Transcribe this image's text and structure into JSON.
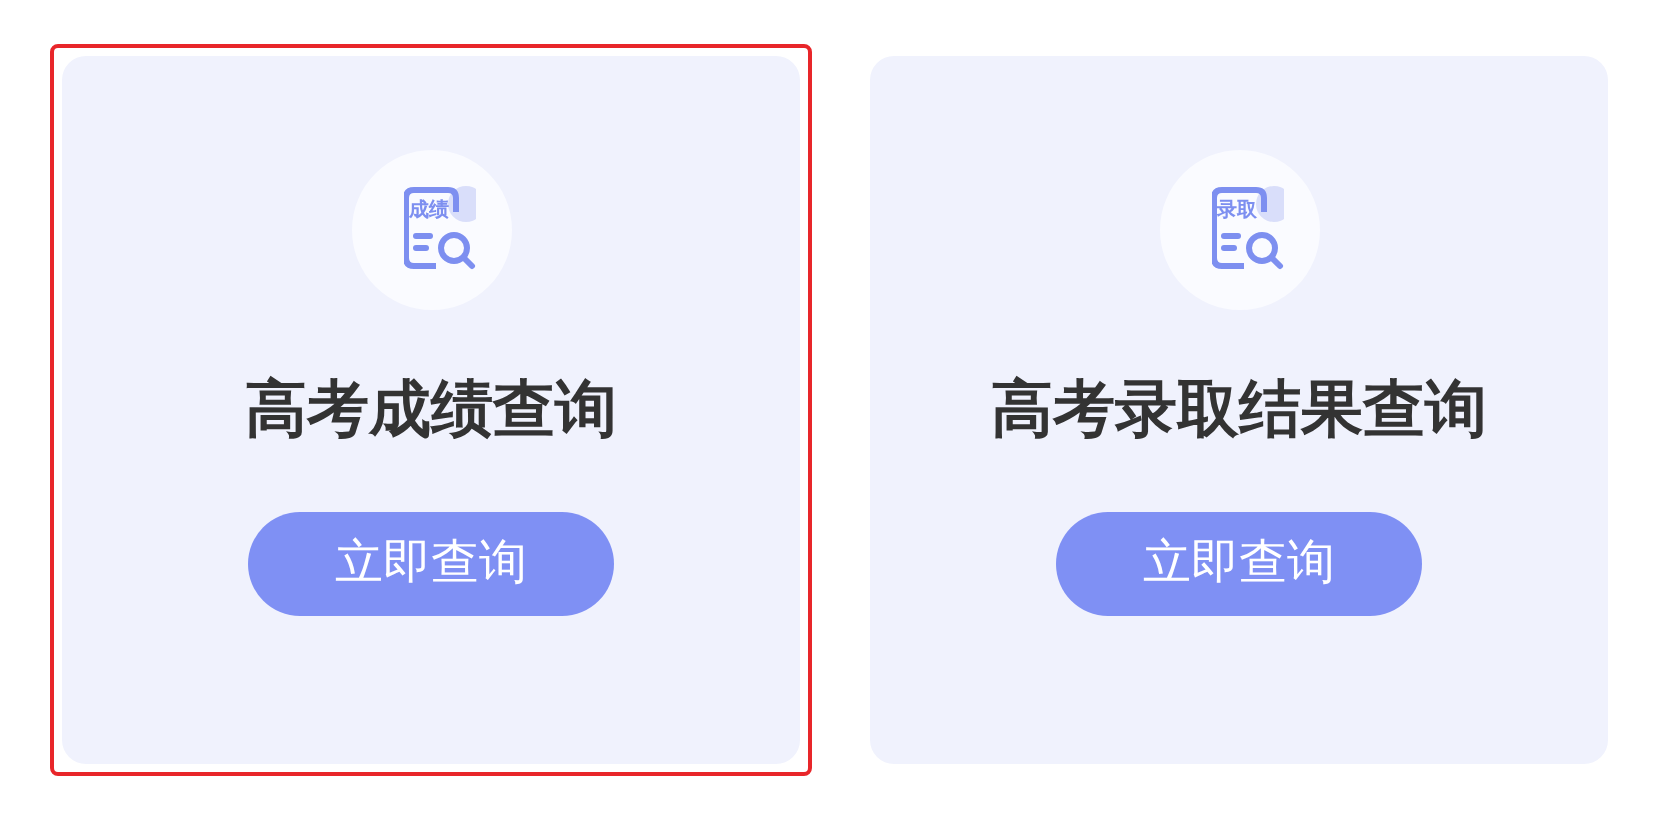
{
  "cards": [
    {
      "icon_label": "成绩",
      "title": "高考成绩查询",
      "button": "立即查询",
      "selected": true
    },
    {
      "icon_label": "录取",
      "title": "高考录取结果查询",
      "button": "立即查询",
      "selected": false
    }
  ]
}
